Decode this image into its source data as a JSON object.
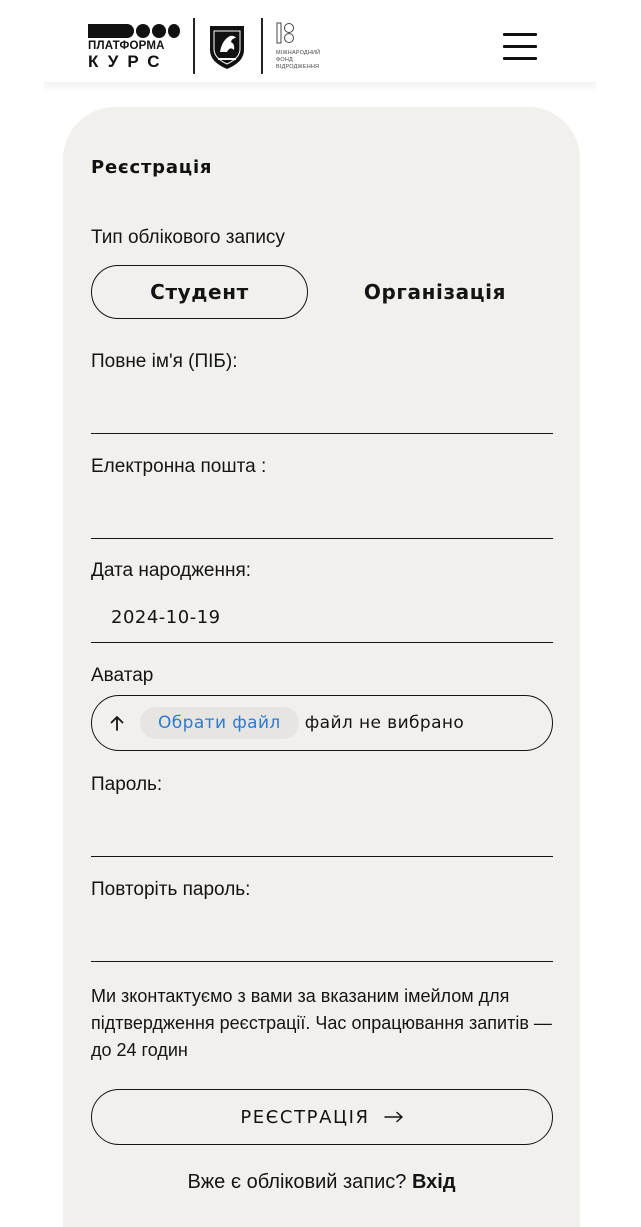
{
  "header": {
    "logo_line1": "ПЛАТФОРМА",
    "logo_line2": "КУРС",
    "partner_text": "Міжнародний\nфонд\nвідродження",
    "menu_icon": "hamburger-menu-icon"
  },
  "form": {
    "title": "Реєстрація",
    "account_type_label": "Тип облікового запису",
    "account_types": [
      {
        "label": "Студент",
        "selected": true
      },
      {
        "label": "Організація",
        "selected": false
      }
    ],
    "full_name_label": "Повне ім'я (ПІБ):",
    "full_name_value": "",
    "email_label": "Електронна пошта :",
    "email_value": "",
    "birth_date_label": "Дата народження:",
    "birth_date_value": "2024-10-19",
    "avatar_label": "Аватар",
    "avatar_button": "Обрати файл",
    "avatar_status": "файл не вибрано",
    "password_label": "Пароль:",
    "password_value": "",
    "repeat_password_label": "Повторіть пароль:",
    "repeat_password_value": "",
    "note": "Ми зконтактуємо з вами за вказаним імейлом для підтвердження реєстрації. Час опрацювання запитів — до 24 годин",
    "submit_label": "РЕЄСТРАЦІЯ",
    "login_prompt": "Вже є обліковий запис?",
    "login_link": "Вхід"
  },
  "colors": {
    "card_background": "#f2f0ec",
    "text": "#141414",
    "file_button_text": "#2f7ad6",
    "file_button_background": "#e6e5e2"
  }
}
